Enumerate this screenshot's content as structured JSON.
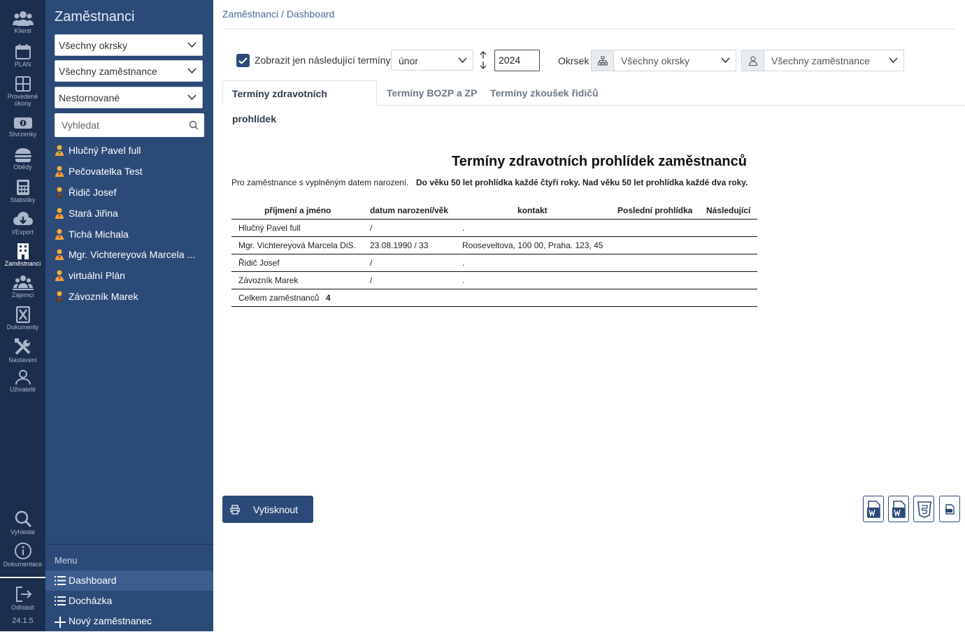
{
  "rail": {
    "items": [
      {
        "label": "Klienti",
        "icon": "users-icon"
      },
      {
        "label": "PLAN",
        "icon": "calendar-icon"
      },
      {
        "label": "Provedené úkony",
        "icon": "grid-icon"
      },
      {
        "label": "Stvrzenky",
        "icon": "money-icon"
      },
      {
        "label": "Obědy",
        "icon": "burger-icon"
      },
      {
        "label": "Statistiky",
        "icon": "calculator-icon"
      },
      {
        "label": "I/Export",
        "icon": "cloud-download-icon"
      },
      {
        "label": "Zaměstnanci",
        "icon": "building-icon"
      },
      {
        "label": "Zájemci",
        "icon": "group-icon"
      },
      {
        "label": "Dokumenty",
        "icon": "document-icon"
      },
      {
        "label": "Nastavení",
        "icon": "tools-icon"
      },
      {
        "label": "Uživatelé",
        "icon": "user-icon"
      }
    ],
    "search_label": "Vyhledat",
    "docs_label": "Dokumentace",
    "logout_label": "Odhlásit",
    "version": "24.1.5"
  },
  "sidebar": {
    "title": "Zaměstnanci",
    "filter_district": "Všechny okrsky",
    "filter_employees": "Všechny zaměstnance",
    "filter_state": "Nestornované",
    "search_placeholder": "Vyhledat",
    "employees": [
      "Hlučný Pavel full",
      "Pečovatelka Test",
      "Řidič Josef",
      "Stará Jiřina",
      "Tichá Michala",
      "Mgr. Vichtereyová Marcela ...",
      "virtuální Plán",
      "Závozník Marek"
    ],
    "menu_title": "Menu",
    "menu": [
      "Dashboard",
      "Docházka",
      "Nový zaměstnanec"
    ]
  },
  "main": {
    "breadcrumb": "Zaměstnanci / Dashboard",
    "only_upcoming_label": "Zobrazit jen následující termíny",
    "only_upcoming_checked": true,
    "month": "únor",
    "year": "2024",
    "district_label": "Okrsek",
    "district_value": "Všechny okrsky",
    "employee_value": "Všechny zaměstnance",
    "tabs": [
      "Termíny zdravotních prohlídek",
      "Termíny BOZP a ZP",
      "Termíny zkoušek řidičů"
    ],
    "active_tab": 0,
    "print_label": "Vytisknout",
    "export_icons": [
      "word-icon",
      "word-icon",
      "html5-icon",
      "pdf-icon"
    ]
  },
  "report": {
    "title": "Termíny zdravotních prohlídek zaměstnanců",
    "note1": "Pro zaměstnance s vyplněným datem narození.",
    "note2": "Do věku 50 let prohlídka každé čtyři roky. Nad věku 50 let prohlídka každé dva roky.",
    "columns": [
      "příjmení a jméno",
      "datum narození/věk",
      "kontakt",
      "Poslední prohlídka",
      "Následující"
    ],
    "rows": [
      {
        "name": "Hlučný Pavel full",
        "birth": "/",
        "contact": ".",
        "last": "",
        "next": ""
      },
      {
        "name": "Mgr. Vichtereyová Marcela DiS.",
        "birth": "23.08.1990 / 33",
        "contact": "Rooseveltova, 100 00, Praha. 123, 45",
        "last": "",
        "next": ""
      },
      {
        "name": "Řidič Josef",
        "birth": "/",
        "contact": ".",
        "last": "",
        "next": ""
      },
      {
        "name": "Závozník Marek",
        "birth": "/",
        "contact": ".",
        "last": "",
        "next": ""
      }
    ],
    "total_label": "Celkem zaměstnanců",
    "total_value": "4"
  }
}
